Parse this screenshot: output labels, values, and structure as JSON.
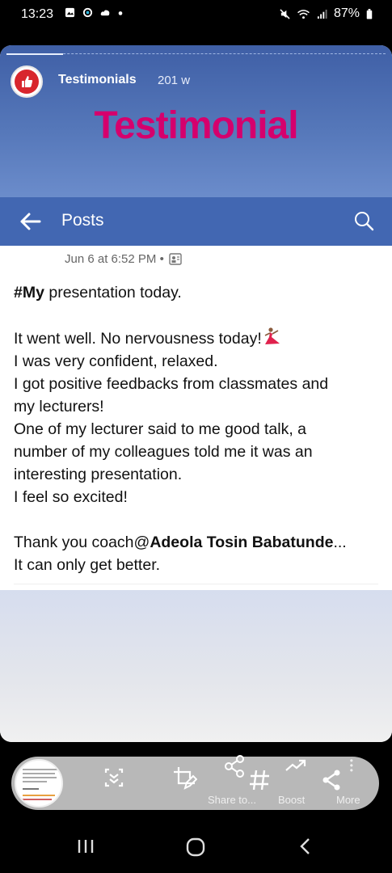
{
  "status_bar": {
    "time": "13:23",
    "battery": "87%",
    "left_icons": [
      "gallery-icon",
      "sync-icon",
      "cloud-icon",
      "dot-icon"
    ],
    "right_icons": [
      "mute-icon",
      "wifi-icon",
      "signal-icon",
      "battery-icon"
    ]
  },
  "banner": {
    "page_name": "Testimonials",
    "age": "201 w",
    "title": "Testimonial",
    "title_color": "#d5006d"
  },
  "nav": {
    "title": "Posts",
    "bar_color": "#4267b2"
  },
  "post": {
    "timestamp": "Jun 6 at 6:52 PM •",
    "hashtag_prefix": "#",
    "hashtag_bold": "My",
    "first_line_rest": " presentation today.",
    "line_1": "It went well. No nervousness today!",
    "line_2": "I was very confident, relaxed.",
    "line_3": "I got positive feedbacks from classmates and",
    "line_4": "my lecturers!",
    "line_5": "One of my lecturer said to me good talk, a",
    "line_6": "number of my colleagues told me it was an",
    "line_7": "interesting presentation.",
    "line_8": "I feel so excited!",
    "thanks_prefix": "Thank you coach@",
    "thanks_name": "Adeola Tosin Babatunde",
    "thanks_suffix": "...",
    "closing": "It can only get better."
  },
  "toolbar": {
    "share_label": "Share to...",
    "boost_label": "Boost",
    "more_label": "More"
  }
}
